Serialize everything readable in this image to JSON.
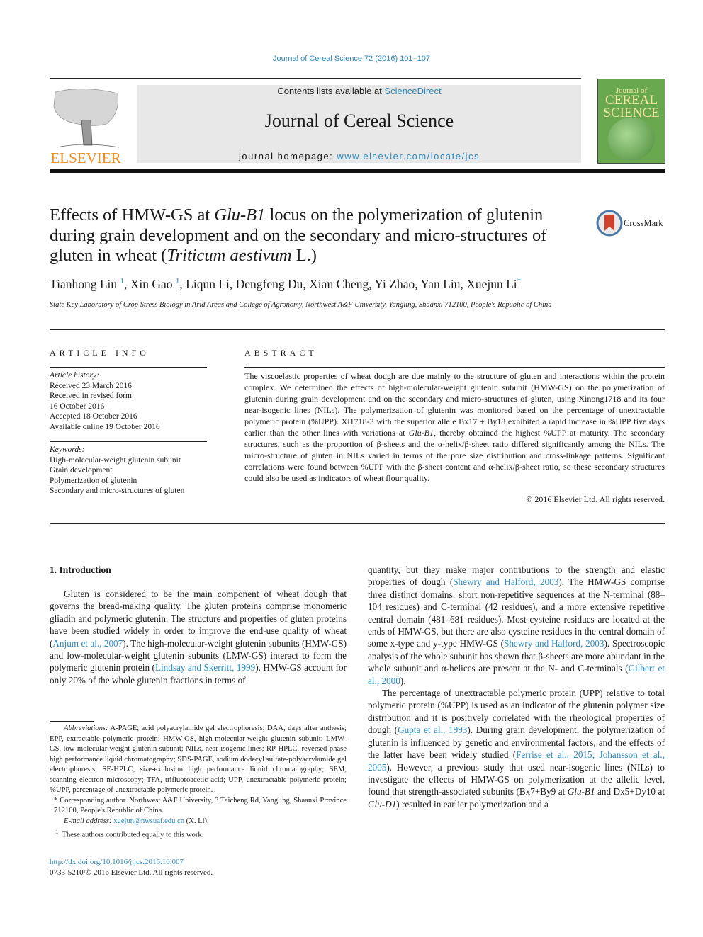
{
  "header": {
    "citation": "Journal of Cereal Science 72 (2016) 101–107",
    "contents_prefix": "Contents lists available at ",
    "contents_link": "ScienceDirect",
    "journal_name": "Journal of Cereal Science",
    "homepage_prefix": "journal homepage: ",
    "homepage_link": "www.elsevier.com/locate/jcs",
    "publisher_logo_text": "ELSEVIER",
    "cover": {
      "line1": "Journal of",
      "line2": "CEREAL",
      "line3": "SCIENCE"
    },
    "colors": {
      "link": "#2a8ac0",
      "publisher": "#f08a1c",
      "cover_green": "#6aa84f",
      "box_gray": "#e8e8e8"
    }
  },
  "article": {
    "title_parts": {
      "t1": "Effects of HMW-GS at ",
      "t2_italic": "Glu-B1",
      "t3": " locus on the polymerization of glutenin during grain development and on the secondary and micro-structures of gluten in wheat (",
      "t4_italic": "Triticum aestivum",
      "t5": " L.)"
    },
    "crossmark_label": "CrossMark",
    "authors": [
      {
        "name": "Tianhong Liu",
        "mark": "1"
      },
      {
        "name": "Xin Gao",
        "mark": "1"
      },
      {
        "name": "Liqun Li",
        "mark": ""
      },
      {
        "name": "Dengfeng Du",
        "mark": ""
      },
      {
        "name": "Xian Cheng",
        "mark": ""
      },
      {
        "name": "Yi Zhao",
        "mark": ""
      },
      {
        "name": "Yan Liu",
        "mark": ""
      },
      {
        "name": "Xuejun Li",
        "mark": "*"
      }
    ],
    "affiliation": "State Key Laboratory of Crop Stress Biology in Arid Areas and College of Agronomy, Northwest A&F University, Yangling, Shaanxi 712100, People's Republic of China"
  },
  "article_info": {
    "heading": "ARTICLE INFO",
    "history_label": "Article history:",
    "history": [
      "Received 23 March 2016",
      "Received in revised form",
      "16 October 2016",
      "Accepted 18 October 2016",
      "Available online 19 October 2016"
    ],
    "keywords_label": "Keywords:",
    "keywords": [
      "High-molecular-weight glutenin subunit",
      "Grain development",
      "Polymerization of glutenin",
      "Secondary and micro-structures of gluten"
    ]
  },
  "abstract": {
    "heading": "ABSTRACT",
    "p1": "The viscoelastic properties of wheat dough are due mainly to the structure of gluten and interactions within the protein complex. We determined the effects of high-molecular-weight glutenin subunit (HMW-GS) on the polymerization of glutenin during grain development and on the secondary and micro-structures of gluten, using Xinong1718 and its four near-isogenic lines (NILs). The polymerization of glutenin was monitored based on the percentage of unextractable polymeric protein (%UPP). Xi1718-3 with the superior allele Bx17 + By18 exhibited a rapid increase in %UPP five days earlier than the other lines with variations at ",
    "p1_italic": "Glu-B1",
    "p2": ", thereby obtained the highest %UPP at maturity. The secondary structures, such as the proportion of β-sheets and the α-helix/β-sheet ratio differed significantly among the NILs. The micro-structure of gluten in NILs varied in terms of the pore size distribution and cross-linkage patterns. Significant correlations were found between %UPP with the β-sheet content and α-helix/β-sheet ratio, so these secondary structures could also be used as indicators of wheat flour quality.",
    "copyright": "© 2016 Elsevier Ltd. All rights reserved."
  },
  "intro": {
    "heading": "1.  Introduction",
    "left_p1": {
      "a": "Gluten is considered to be the main component of wheat dough that governs the bread-making quality. The gluten proteins comprise monomeric gliadin and polymeric glutenin. The structure and properties of gluten proteins have been studied widely in order to improve the end-use quality of wheat (",
      "ref1": "Anjum et al., 2007",
      "b": "). The high-molecular-weight glutenin subunits (HMW-GS) and low-molecular-weight glutenin subunits (LMW-GS) interact to form the polymeric glutenin protein (",
      "ref2": "Lindsay and Skerritt, 1999",
      "c": "). HMW-GS account for only 20% of the whole glutenin fractions in terms of"
    },
    "right_p1": {
      "a": "quantity, but they make major contributions to the strength and elastic properties of dough (",
      "ref1": "Shewry and Halford, 2003",
      "b": "). The HMW-GS comprise three distinct domains: short non-repetitive sequences at the N-terminal (88–104 residues) and C-terminal (42 residues), and a more extensive repetitive central domain (481–681 residues). Most cysteine residues are located at the ends of HMW-GS, but there are also cysteine residues in the central domain of some x-type and y-type HMW-GS (",
      "ref2": "Shewry and Halford, 2003",
      "c": "). Spectroscopic analysis of the whole subunit has shown that β-sheets are more abundant in the whole subunit and α-helices are present at the N- and C-terminals (",
      "ref3": "Gilbert et al., 2000",
      "d": ")."
    },
    "right_p2": {
      "a": "The percentage of unextractable polymeric protein (UPP) relative to total polymeric protein (%UPP) is used as an indicator of the glutenin polymer size distribution and it is positively correlated with the rheological properties of dough (",
      "ref1": "Gupta et al., 1993",
      "b": "). During grain development, the polymerization of glutenin is influenced by genetic and environmental factors, and the effects of the latter have been widely studied (",
      "ref2": "Ferrise et al., 2015; Johansson et al., 2005",
      "c": "). However, a previous study that used near-isogenic lines (NILs) to investigate the effects of HMW-GS on polymerization at the allelic level, found that strength-associated subunits (Bx7+By9 at ",
      "i1": "Glu-B1",
      "d": " and Dx5+Dy10 at ",
      "i2": "Glu-D1",
      "e": ") resulted in earlier polymerization and a"
    }
  },
  "footnotes": {
    "abbrev_label": "Abbreviations:",
    "abbrev_text": " A-PAGE, acid polyacrylamide gel electrophoresis; DAA, days after anthesis; EPP, extractable polymeric protein; HMW-GS, high-molecular-weight glutenin subunit; LMW-GS, low-molecular-weight glutenin subunit; NILs, near-isogenic lines; RP-HPLC, reversed-phase high performance liquid chromatography; SDS-PAGE, sodium dodecyl sulfate-polyacrylamide gel electrophoresis; SE-HPLC, size-exclusion high performance liquid chromatography; SEM, scanning electron microscopy; TFA, trifluoroacetic acid; UPP, unextractable polymeric protein; %UPP, percentage of unextractable polymeric protein.",
    "corresponding": "* Corresponding author. Northwest A&F University, 3 Taicheng Rd, Yangling, Shaanxi Province 712100, People's Republic of China.",
    "email_label": "E-mail address:",
    "email": "xuejun@nwsuaf.edu.cn",
    "email_suffix": " (X. Li).",
    "equal_mark": "1",
    "equal_text": "These authors contributed equally to this work."
  },
  "footer": {
    "doi": "http://dx.doi.org/10.1016/j.jcs.2016.10.007",
    "issn": "0733-5210/© 2016 Elsevier Ltd. All rights reserved."
  }
}
